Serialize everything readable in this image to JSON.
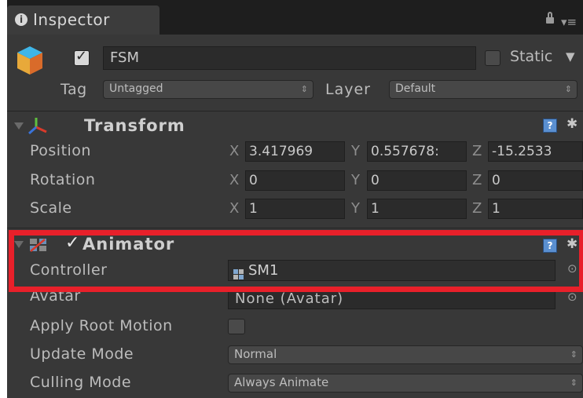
{
  "tab": {
    "title": "Inspector",
    "info_glyph": "i"
  },
  "header": {
    "object_name": "FSM",
    "active": true,
    "static_label": "Static",
    "static_checked": false,
    "tag_label": "Tag",
    "tag_value": "Untagged",
    "layer_label": "Layer",
    "layer_value": "Default"
  },
  "transform": {
    "title": "Transform",
    "rows": [
      {
        "label": "Position",
        "x": "3.417969",
        "y": "0.557678:",
        "z": "-15.2533"
      },
      {
        "label": "Rotation",
        "x": "0",
        "y": "0",
        "z": "0"
      },
      {
        "label": "Scale",
        "x": "1",
        "y": "1",
        "z": "1"
      }
    ],
    "axis_x": "X",
    "axis_y": "Y",
    "axis_z": "Z"
  },
  "animator": {
    "title": "Animator",
    "enabled": true,
    "controller_label": "Controller",
    "controller_value": "SM1",
    "avatar_label": "Avatar",
    "avatar_value": "None (Avatar)",
    "apply_root_motion_label": "Apply Root Motion",
    "apply_root_motion_checked": false,
    "update_mode_label": "Update Mode",
    "update_mode_value": "Normal",
    "culling_mode_label": "Culling Mode",
    "culling_mode_value": "Always Animate"
  },
  "help_glyph": "?",
  "gear_glyph": "✱",
  "colors": {
    "highlight": "#e8202a",
    "panel": "#383838",
    "field": "#2b2b2b"
  }
}
